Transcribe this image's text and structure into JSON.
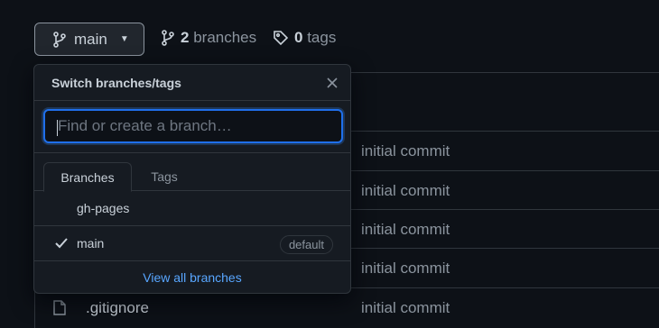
{
  "topbar": {
    "branch_button_label": "main",
    "branches_count": "2",
    "branches_label": "branches",
    "tags_count": "0",
    "tags_label": "tags"
  },
  "file_table": {
    "rows": [
      {
        "name": "",
        "message": "initial commit"
      },
      {
        "name": "",
        "message": "initial commit"
      },
      {
        "name": "",
        "message": "initial commit"
      },
      {
        "name": "",
        "message": "initial commit"
      },
      {
        "name": ".gitignore",
        "message": "initial commit"
      }
    ]
  },
  "dropdown": {
    "title": "Switch branches/tags",
    "filter_placeholder": "Find or create a branch…",
    "filter_value": "",
    "tabs": [
      {
        "label": "Branches",
        "active": true
      },
      {
        "label": "Tags",
        "active": false
      }
    ],
    "items": [
      {
        "label": "gh-pages",
        "selected": false,
        "badge": ""
      },
      {
        "label": "main",
        "selected": true,
        "badge": "default"
      }
    ],
    "footer_link": "View all branches"
  },
  "colors": {
    "background": "#0d1117",
    "surface": "#161b22",
    "border": "#30363d",
    "text": "#c9d1d9",
    "muted": "#8b949e",
    "accent": "#58a6ff",
    "focus": "#1f6feb"
  },
  "icons": {
    "branch": "git-branch-icon",
    "tag": "tag-icon",
    "caret": "triangle-down-icon",
    "close": "x-icon",
    "check": "check-icon",
    "file": "file-icon"
  }
}
